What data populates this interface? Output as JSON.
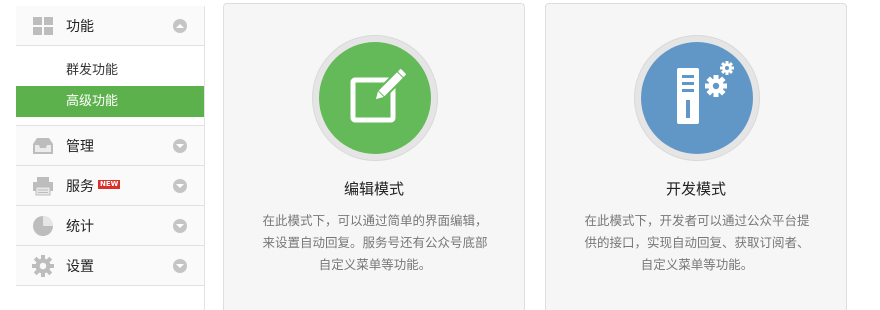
{
  "sidebar": {
    "function": {
      "label": "功能",
      "icon": "grid-icon",
      "chevron": "chevron-up-icon"
    },
    "sub_items": [
      {
        "label": "群发功能",
        "active": false
      },
      {
        "label": "高级功能",
        "active": true
      }
    ],
    "manage": {
      "label": "管理",
      "icon": "inbox-icon",
      "chevron": "chevron-down-icon"
    },
    "service": {
      "label": "服务",
      "badge": "NEW",
      "icon": "printer-icon",
      "chevron": "chevron-down-icon"
    },
    "stats": {
      "label": "统计",
      "icon": "pie-chart-icon",
      "chevron": "chevron-down-icon"
    },
    "settings": {
      "label": "设置",
      "icon": "gear-icon",
      "chevron": "chevron-down-icon"
    }
  },
  "cards": {
    "edit": {
      "title": "编辑模式",
      "desc1": "在此模式下，可以通过简单的界面编辑，",
      "desc2": "来设置自动回复。服务号还有公众号底部",
      "desc3": "自定义菜单等功能。",
      "icon": "edit-pencil-icon",
      "color": "#64b958"
    },
    "dev": {
      "title": "开发模式",
      "desc1": "在此模式下，开发者可以通过公众平台提",
      "desc2": "供的接口，实现自动回复、获取订阅者、",
      "desc3": "自定义菜单等功能。",
      "icon": "server-gear-icon",
      "color": "#6197c6"
    }
  },
  "colors": {
    "active_green": "#5db14c",
    "badge_red": "#d8322a"
  }
}
